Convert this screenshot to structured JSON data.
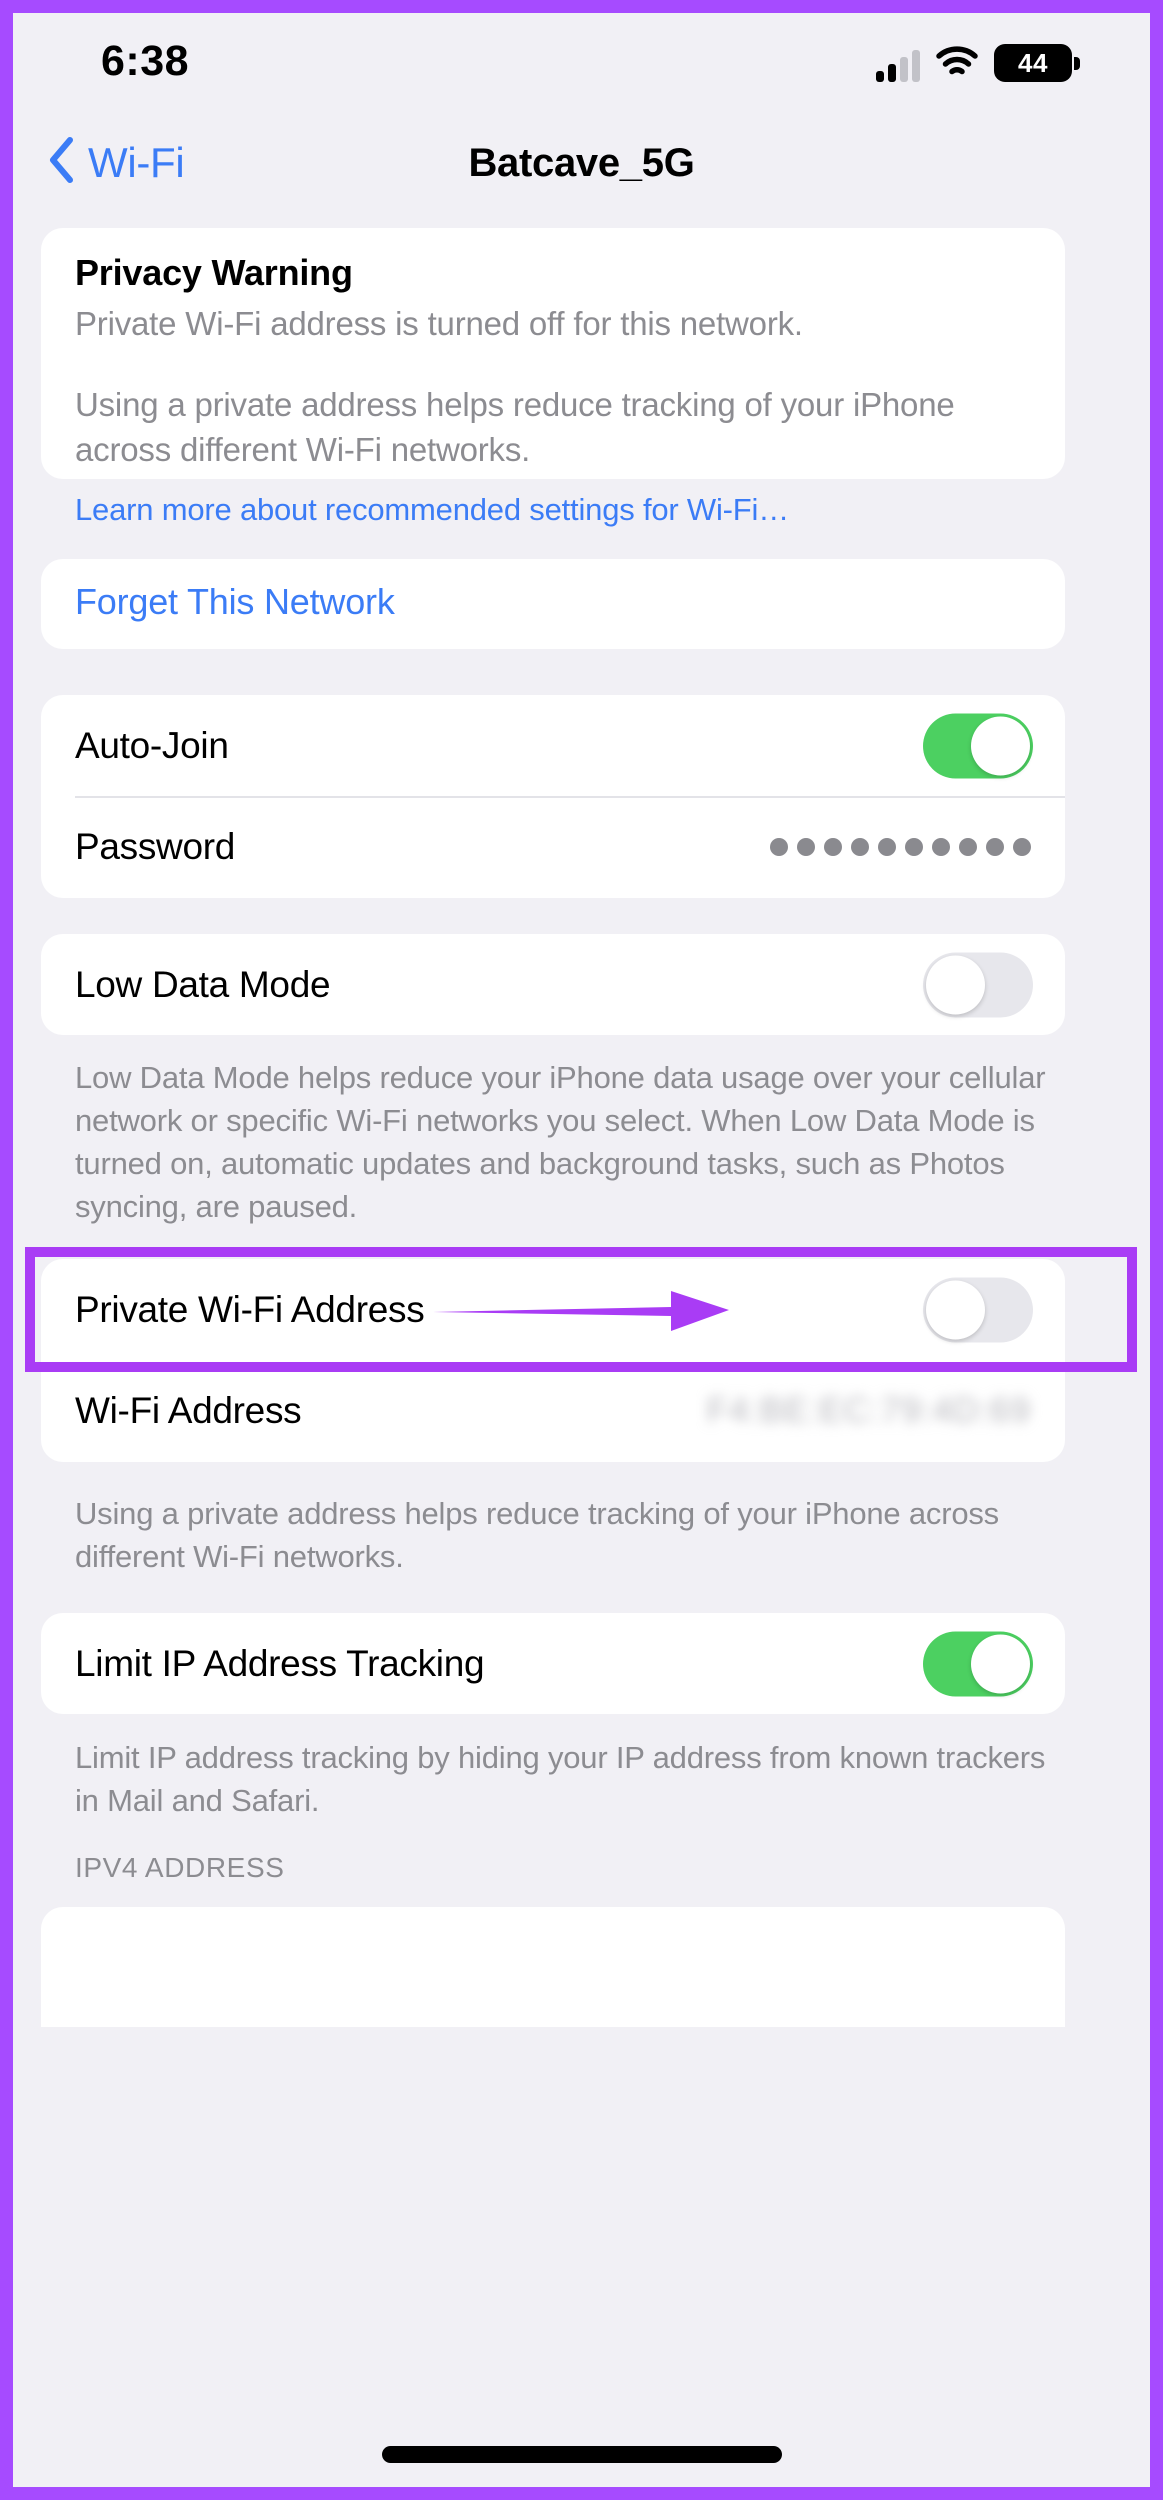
{
  "annotation": {
    "frame_color": "#a64bff",
    "highlight_color": "#a93cf5",
    "arrow_name": "highlight-arrow"
  },
  "status_bar": {
    "time": "6:38",
    "battery_level": "44",
    "signal_icon": "cellular-signal-icon",
    "wifi_icon": "wifi-icon",
    "battery_icon": "battery-icon"
  },
  "nav": {
    "back_label": "Wi-Fi",
    "back_icon": "chevron-left-icon",
    "title": "Batcave_5G"
  },
  "privacy_warning": {
    "title": "Privacy Warning",
    "paragraph_1": "Private Wi-Fi address is turned off for this network.",
    "paragraph_2": "Using a private address helps reduce tracking of your iPhone across different Wi-Fi networks.",
    "learn_more": "Learn more about recommended settings for Wi-Fi…"
  },
  "forget": {
    "label": "Forget This Network"
  },
  "connection": {
    "auto_join_label": "Auto-Join",
    "auto_join_state": "on",
    "password_label": "Password",
    "password_masked": "••••••••••"
  },
  "low_data": {
    "label": "Low Data Mode",
    "state": "off",
    "note": "Low Data Mode helps reduce your iPhone data usage over your cellular network or specific Wi-Fi networks you select. When Low Data Mode is turned on, automatic updates and background tasks, such as Photos syncing, are paused."
  },
  "private_address": {
    "label": "Private Wi-Fi Address",
    "state": "off",
    "wifi_address_label": "Wi-Fi Address",
    "wifi_address_value": "F4:BE:EC:79:4D:69",
    "note": "Using a private address helps reduce tracking of your iPhone across different Wi-Fi networks."
  },
  "limit_ip": {
    "label": "Limit IP Address Tracking",
    "state": "on",
    "note": "Limit IP address tracking by hiding your IP address from known trackers in Mail and Safari."
  },
  "ipv4": {
    "header": "IPV4 ADDRESS"
  },
  "colors": {
    "background": "#f1f0f5",
    "card": "#ffffff",
    "accent_blue": "#3b7cf6",
    "toggle_on": "#4cd061",
    "toggle_off": "#e7e7ec",
    "secondary_text": "#8c8c91"
  }
}
